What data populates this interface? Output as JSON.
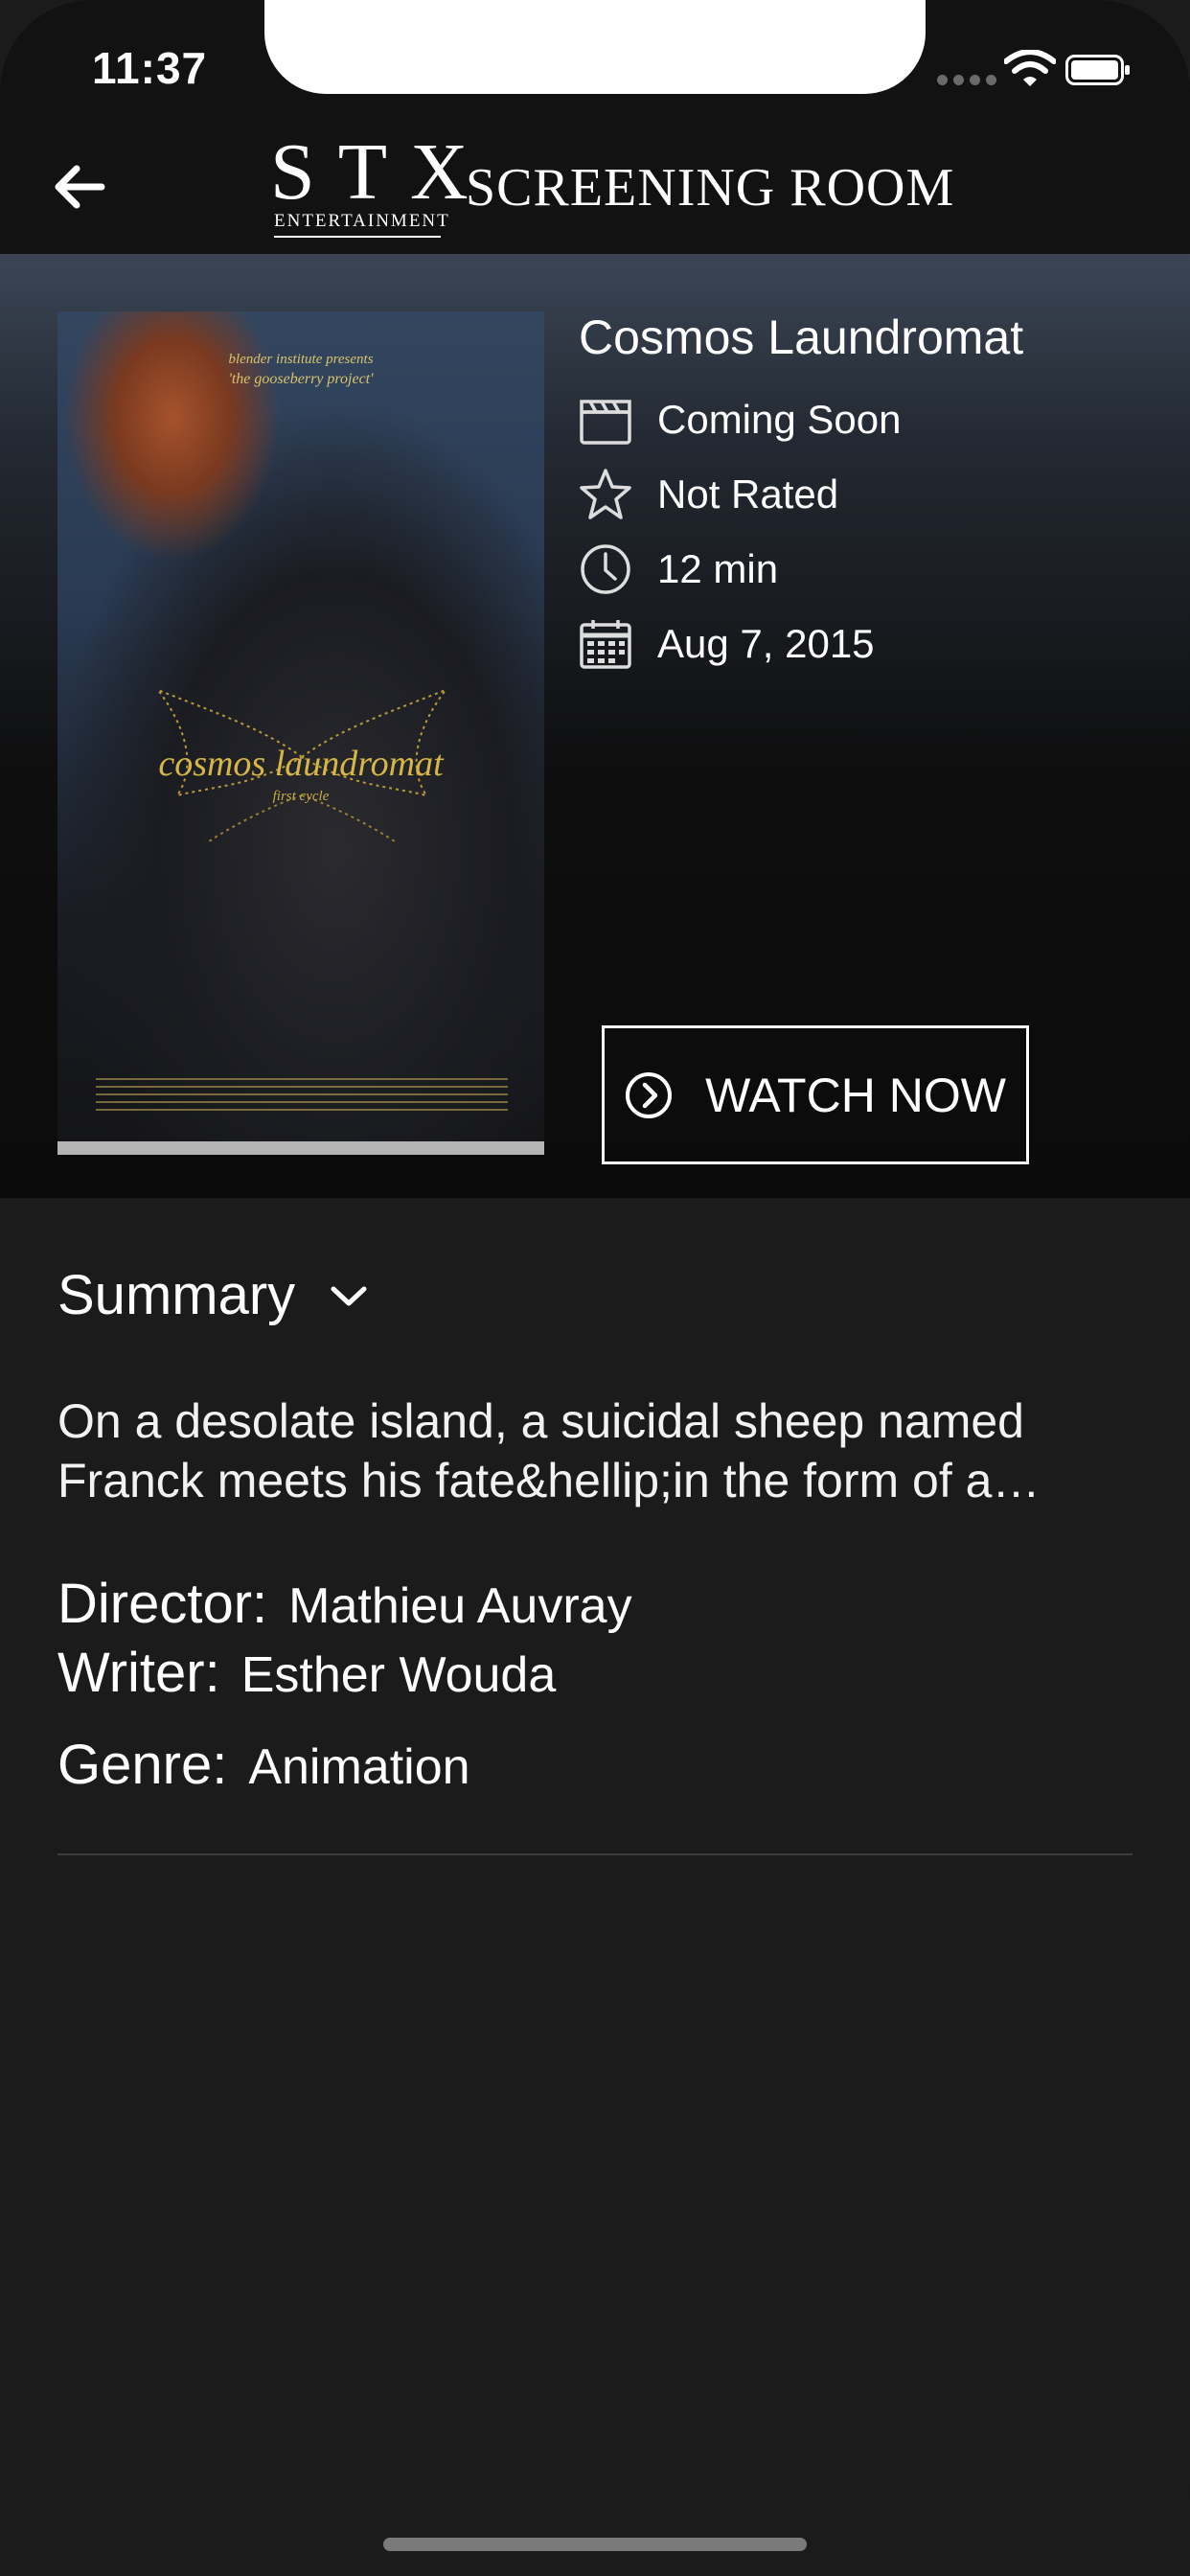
{
  "status": {
    "time": "11:37"
  },
  "header": {
    "logo_main": "STX",
    "logo_sub": "ENTERTAINMENT",
    "logo_room": "SCREENING ROOM"
  },
  "film": {
    "title": "Cosmos Laundromat",
    "status": "Coming Soon",
    "rating": "Not Rated",
    "runtime": "12 min",
    "release_date": "Aug 7, 2015",
    "watch_label": "WATCH NOW",
    "poster": {
      "presents": "blender institute presents",
      "project": "'the gooseberry project'",
      "title": "cosmos laundromat",
      "subtitle": "first cycle"
    }
  },
  "summary": {
    "label": "Summary",
    "text": "On a desolate island, a suicidal sheep named Franck meets his fate&hellip;in the form of a…"
  },
  "credits": {
    "director_label": "Director:",
    "director": "Mathieu Auvray",
    "writer_label": "Writer:",
    "writer": "Esther Wouda",
    "genre_label": "Genre:",
    "genre": "Animation"
  },
  "icons": {
    "back": "arrow-left-icon",
    "status": "clapperboard-icon",
    "rating": "star-icon",
    "runtime": "clock-icon",
    "release": "calendar-icon",
    "watch": "chevron-circle-right-icon",
    "summary_toggle": "chevron-down-icon"
  }
}
